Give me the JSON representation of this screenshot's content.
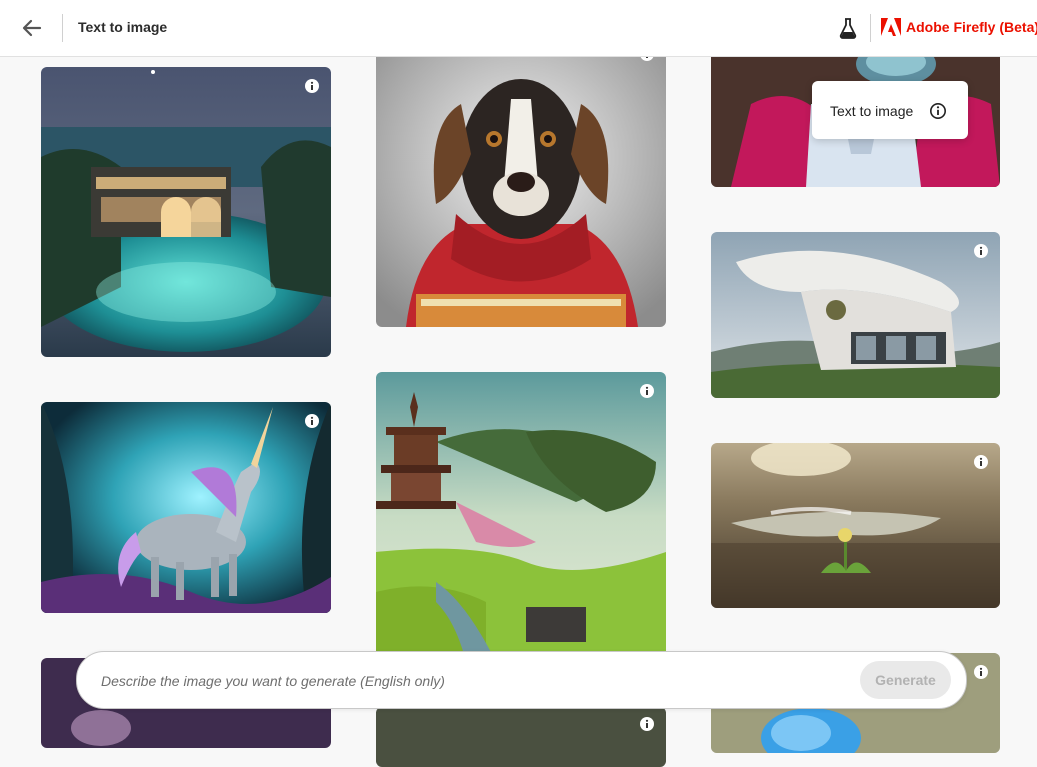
{
  "header": {
    "title": "Text to image",
    "brand": "Adobe Firefly (Beta)",
    "icons": {
      "back": "arrow-left-icon",
      "labs": "flask-icon",
      "logo": "adobe-logo-icon"
    }
  },
  "tooltip": {
    "label": "Text to image",
    "icon": "info-circle-icon"
  },
  "prompt": {
    "placeholder": "Describe the image you want to generate (English only)",
    "value": "",
    "generate_label": "Generate"
  },
  "gallery": {
    "tiles": [
      {
        "subject": "tropical-lagoon-house"
      },
      {
        "subject": "dog-red-sweater"
      },
      {
        "subject": "person-pink-jacket"
      },
      {
        "subject": "modern-curved-house"
      },
      {
        "subject": "fantasy-unicorn"
      },
      {
        "subject": "japanese-pagoda-garden"
      },
      {
        "subject": "sprout-in-mud"
      },
      {
        "subject": "blue-furry-creature"
      }
    ]
  },
  "colors": {
    "brand": "#eb1000",
    "generate_disabled_bg": "#e9e9e9",
    "generate_disabled_text": "#b2b2b2"
  }
}
